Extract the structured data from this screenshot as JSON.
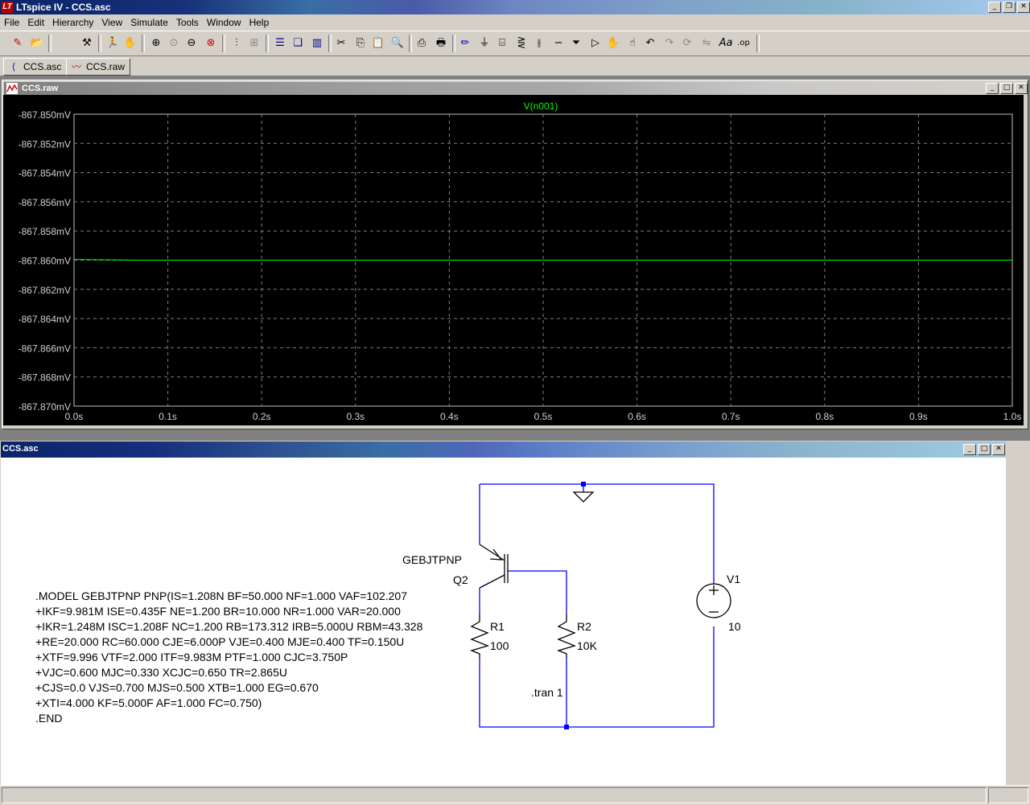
{
  "app": {
    "title": "LTspice IV - CCS.asc",
    "icon_letters": "LT"
  },
  "menu": [
    "File",
    "Edit",
    "Hierarchy",
    "View",
    "Simulate",
    "Tools",
    "Window",
    "Help"
  ],
  "tabs": [
    {
      "label": "CCS.asc"
    },
    {
      "label": "CCS.raw"
    }
  ],
  "waveform_window": {
    "title": "CCS.raw",
    "trace_label": "V(n001)"
  },
  "schematic_window": {
    "title": "CCS.asc",
    "components": {
      "q2_model": "GEBJTPNP",
      "q2_name": "Q2",
      "r1_name": "R1",
      "r1_value": "100",
      "r2_name": "R2",
      "r2_value": "10K",
      "v1_name": "V1",
      "v1_value": "10",
      "tran_directive": ".tran 1"
    },
    "model_lines": [
      ".MODEL GEBJTPNP PNP(IS=1.208N BF=50.000 NF=1.000 VAF=102.207",
      "+IKF=9.981M ISE=0.435F NE=1.200 BR=10.000 NR=1.000 VAR=20.000",
      "+IKR=1.248M ISC=1.208F NC=1.200 RB=173.312 IRB=5.000U RBM=43.328",
      "+RE=20.000 RC=60.000 CJE=6.000P VJE=0.400 MJE=0.400 TF=0.150U",
      "+XTF=9.996 VTF=2.000 ITF=9.983M PTF=1.000 CJC=3.750P",
      "+VJC=0.600 MJC=0.330 XCJC=0.650 TR=2.865U",
      "+CJS=0.0 VJS=0.700 MJS=0.500 XTB=1.000 EG=0.670",
      "+XTI=4.000 KF=5.000F AF=1.000 FC=0.750)",
      ".END"
    ]
  },
  "chart_data": {
    "type": "line",
    "title": "V(n001)",
    "xlabel": "",
    "ylabel": "",
    "xlim": [
      0.0,
      1.0
    ],
    "ylim": [
      -867.87,
      -867.85
    ],
    "x_unit": "s",
    "y_unit": "mV",
    "x_ticks": [
      "0.0s",
      "0.1s",
      "0.2s",
      "0.3s",
      "0.4s",
      "0.5s",
      "0.6s",
      "0.7s",
      "0.8s",
      "0.9s",
      "1.0s"
    ],
    "y_ticks": [
      "-867.850mV",
      "-867.852mV",
      "-867.854mV",
      "-867.856mV",
      "-867.858mV",
      "-867.860mV",
      "-867.862mV",
      "-867.864mV",
      "-867.866mV",
      "-867.868mV",
      "-867.870mV"
    ],
    "grid": true,
    "background": "#000000",
    "trace_color": "#00ff00",
    "series": [
      {
        "name": "V(n001)",
        "x": [
          0.0,
          0.07,
          0.2,
          0.203,
          1.0
        ],
        "y": [
          -867.85995,
          -867.86,
          -867.86,
          -867.86,
          -867.86
        ]
      }
    ]
  },
  "colors": {
    "wire": "#0000ff",
    "component": "#000000",
    "grid": "#7f7f7f",
    "axis_text": "#d0d0d0"
  }
}
